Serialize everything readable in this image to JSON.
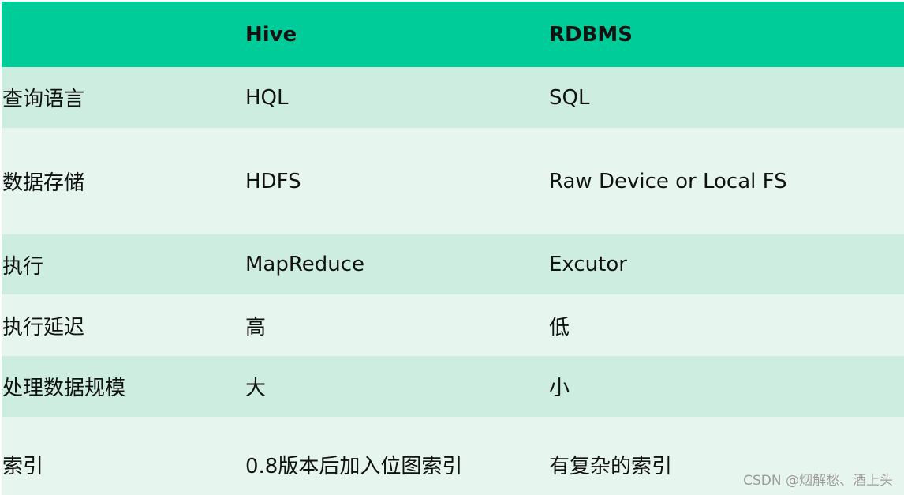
{
  "table": {
    "headers": [
      "",
      "Hive",
      "RDBMS"
    ],
    "rows": [
      [
        "查询语言",
        "HQL",
        "SQL"
      ],
      [
        "数据存储",
        "HDFS",
        "Raw Device or Local FS"
      ],
      [
        "执行",
        "MapReduce",
        "Excutor"
      ],
      [
        "执行延迟",
        "高",
        "低"
      ],
      [
        "处理数据规模",
        "大",
        "小"
      ],
      [
        "索引",
        "0.8版本后加入位图索引",
        "有复杂的索引"
      ]
    ]
  },
  "colors": {
    "header_bg": "#00cc99",
    "row_odd_bg": "#cdede0",
    "row_even_bg": "#e6f6ef"
  },
  "watermark": "CSDN @烟解愁、酒上头"
}
